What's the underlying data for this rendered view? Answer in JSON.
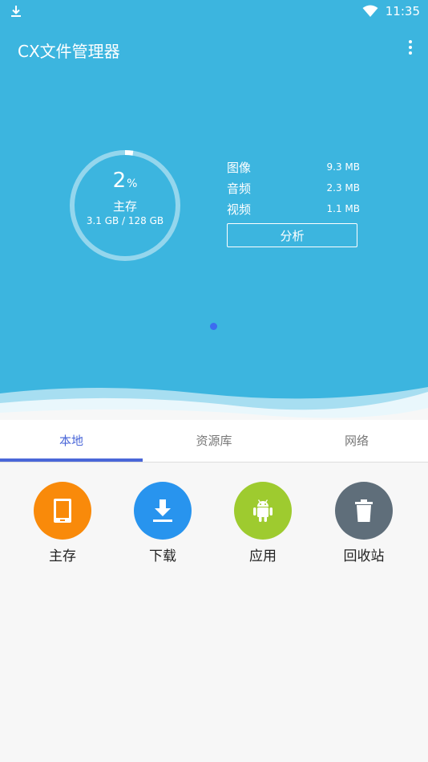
{
  "status_bar": {
    "time": "11:35"
  },
  "app_bar": {
    "title": "CX文件管理器"
  },
  "storage": {
    "percent": "2",
    "percent_unit": "%",
    "label": "主存",
    "usage": "3.1 GB / 128 GB",
    "used_fraction": 0.024
  },
  "stats": [
    {
      "name": "图像",
      "size": "9.3 MB"
    },
    {
      "name": "音频",
      "size": "2.3 MB"
    },
    {
      "name": "视频",
      "size": "1.1 MB"
    }
  ],
  "analyze_label": "分析",
  "tabs": [
    {
      "label": "本地",
      "active": true
    },
    {
      "label": "资源库",
      "active": false
    },
    {
      "label": "网络",
      "active": false
    }
  ],
  "shortcuts": [
    {
      "label": "主存",
      "icon": "tablet-icon",
      "color": "#f98a0a"
    },
    {
      "label": "下载",
      "icon": "download-icon",
      "color": "#2894ee"
    },
    {
      "label": "应用",
      "icon": "android-icon",
      "color": "#9ecb2f"
    },
    {
      "label": "回收站",
      "icon": "trash-icon",
      "color": "#5f6e7a"
    }
  ],
  "colors": {
    "hero_bg": "#3cb5df",
    "accent": "#4a67d8",
    "page_dot": "#3d6cf0"
  }
}
